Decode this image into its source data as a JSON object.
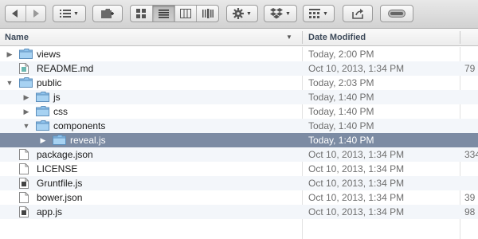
{
  "toolbar": {
    "nav": [
      "back-icon",
      "forward-icon"
    ],
    "arrange_icon": "list-arrange-icon",
    "new_folder_icon": "new-folder-icon",
    "views": [
      "icon-view-icon",
      "list-view-icon",
      "column-view-icon",
      "coverflow-view-icon"
    ],
    "active_view": "list-view-icon",
    "action_icon": "gear-icon",
    "dropbox_icon": "dropbox-icon",
    "group_icon": "group-icon",
    "share_icon": "share-icon",
    "toggle_icon": "toggle-icon"
  },
  "columns": {
    "name": "Name",
    "date": "Date Modified"
  },
  "files": [
    {
      "name": "views",
      "date": "Today, 2:00 PM",
      "size": "",
      "kind": "folder",
      "level": 0,
      "disclosure": "collapsed"
    },
    {
      "name": "README.md",
      "date": "Oct 10, 2013, 1:34 PM",
      "size": "79",
      "kind": "md",
      "level": 0,
      "disclosure": "none"
    },
    {
      "name": "public",
      "date": "Today, 2:03 PM",
      "size": "",
      "kind": "folder",
      "level": 0,
      "disclosure": "expanded"
    },
    {
      "name": "js",
      "date": "Today, 1:40 PM",
      "size": "",
      "kind": "folder",
      "level": 1,
      "disclosure": "collapsed"
    },
    {
      "name": "css",
      "date": "Today, 1:40 PM",
      "size": "",
      "kind": "folder",
      "level": 1,
      "disclosure": "collapsed"
    },
    {
      "name": "components",
      "date": "Today, 1:40 PM",
      "size": "",
      "kind": "folder",
      "level": 1,
      "disclosure": "expanded"
    },
    {
      "name": "reveal.js",
      "date": "Today, 1:40 PM",
      "size": "",
      "kind": "folder",
      "level": 2,
      "disclosure": "collapsed",
      "selected": true
    },
    {
      "name": "package.json",
      "date": "Oct 10, 2013, 1:34 PM",
      "size": "334",
      "kind": "doc",
      "level": 0,
      "disclosure": "none"
    },
    {
      "name": "LICENSE",
      "date": "Oct 10, 2013, 1:34 PM",
      "size": "",
      "kind": "doc",
      "level": 0,
      "disclosure": "none"
    },
    {
      "name": "Gruntfile.js",
      "date": "Oct 10, 2013, 1:34 PM",
      "size": "",
      "kind": "js",
      "level": 0,
      "disclosure": "none"
    },
    {
      "name": "bower.json",
      "date": "Oct 10, 2013, 1:34 PM",
      "size": "39",
      "kind": "doc",
      "level": 0,
      "disclosure": "none"
    },
    {
      "name": "app.js",
      "date": "Oct 10, 2013, 1:34 PM",
      "size": "98",
      "kind": "js",
      "level": 0,
      "disclosure": "none"
    }
  ]
}
